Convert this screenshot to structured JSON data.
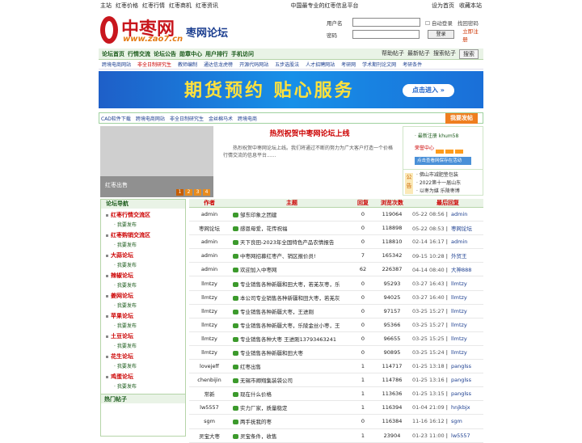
{
  "top": {
    "left_links": [
      "主站",
      "红枣价格",
      "红枣行情",
      "红枣商机",
      "红枣资讯"
    ],
    "center": "中国最专业的红枣信息平台",
    "right_links": [
      "设为首页",
      "收藏本站"
    ]
  },
  "logo": {
    "cn": "中枣网",
    "cn2": "枣网论坛",
    "url": "www.zao7.cn"
  },
  "login": {
    "username_label": "用户名",
    "password_label": "密码",
    "remember_label": "自动登录",
    "forgot_label": "找回密码",
    "login_button": "登录",
    "register_link": "立即注册"
  },
  "nav": {
    "items": [
      "论坛首页",
      "行情交流",
      "论坛公告",
      "勋章中心",
      "用户排行",
      "手机访问"
    ],
    "right": [
      "帮助帖子",
      "最新帖子",
      "搜索帖子"
    ],
    "search_button": "搜索"
  },
  "sub_nav": [
    {
      "label": "跨境电商网站",
      "hot": false
    },
    {
      "label": "非全日制研究生",
      "hot": true
    },
    {
      "label": "教师编制",
      "hot": false
    },
    {
      "label": "通达信龙虎榜",
      "hot": false
    },
    {
      "label": "开源代码网站",
      "hot": false
    },
    {
      "label": "五步选股法",
      "hot": false
    },
    {
      "label": "人才招聘网站",
      "hot": false
    },
    {
      "label": "考研网",
      "hot": false
    },
    {
      "label": "学术期刊论文网",
      "hot": false
    },
    {
      "label": "考研条件",
      "hot": false
    }
  ],
  "banner": {
    "title": "期货预约 贴心服务",
    "button": "点击进入 »"
  },
  "ticker": {
    "items": [
      "CAD软件下载",
      "跨境电商网站",
      "非全日制研究生",
      "金丝棉马术",
      "跨境电商"
    ],
    "post_button": "我要发帖"
  },
  "slider": {
    "caption": "红枣出售",
    "pages": [
      "1",
      "2",
      "3",
      "4"
    ],
    "active": 0
  },
  "news": {
    "headline": "热烈祝贺中枣网论坛上线",
    "body": "热烈祝贺中枣网论坛上线。我们将通过不断的努力为广大客户打造一个价格行情交流的信息平台......"
  },
  "info": {
    "newest": "最新注册 khum58",
    "honor": "荣誉中心",
    "ad": "点击查看网保存在活动",
    "ann_label": "公告",
    "announcements": [
      "佛山市减肥垫包装",
      "2022第十一届山东",
      "以枣为媒 乐陵枣博"
    ]
  },
  "sidebar": {
    "title": "论坛导航",
    "groups": [
      {
        "name": "红枣行情交流区",
        "sub": "我要发布"
      },
      {
        "name": "红枣购销交流区",
        "sub": "我要发布"
      },
      {
        "name": "大蒜论坛",
        "sub": "我要发布"
      },
      {
        "name": "辣椒论坛",
        "sub": "我要发布"
      },
      {
        "name": "姜网论坛",
        "sub": "我要发布"
      },
      {
        "name": "苹果论坛",
        "sub": "我要发布"
      },
      {
        "name": "土豆论坛",
        "sub": "我要发布"
      },
      {
        "name": "花生论坛",
        "sub": "我要发布"
      },
      {
        "name": "鸡蛋论坛",
        "sub": "我要发布"
      }
    ],
    "hot_title": "热门帖子"
  },
  "table": {
    "headers": [
      "作者",
      "主题",
      "回复",
      "浏览次数",
      "最后回复"
    ],
    "rows": [
      {
        "author": "admin",
        "subject": "邹东印象之团建",
        "replies": "0",
        "views": "119064",
        "date": "05-22 08:56",
        "last": "admin"
      },
      {
        "author": "枣网论坛",
        "subject": "感恩母爱，花传祝福",
        "replies": "0",
        "views": "118898",
        "date": "05-22 08:53",
        "last": "枣网论坛"
      },
      {
        "author": "admin",
        "subject": "天下良田-2023年全国特色产品农情报告",
        "replies": "0",
        "views": "118810",
        "date": "02-14 16:17",
        "last": "admin"
      },
      {
        "author": "admin",
        "subject": "中枣网招募红枣产、销区报价员!",
        "replies": "7",
        "views": "165342",
        "date": "09-15 10:28",
        "last": "外贸王"
      },
      {
        "author": "admin",
        "subject": "欢迎加入中枣网",
        "replies": "62",
        "views": "226387",
        "date": "04-14 08:40",
        "last": "大神888"
      },
      {
        "author": "llmtzy",
        "subject": "专业销售各种新疆和田大枣，若羌灰枣，乐",
        "replies": "0",
        "views": "95293",
        "date": "03-27 16:43",
        "last": "llmtzy"
      },
      {
        "author": "llmtzy",
        "subject": "本公司专业销售各种新疆和田大枣，若羌灰",
        "replies": "0",
        "views": "94025",
        "date": "03-27 16:40",
        "last": "llmtzy"
      },
      {
        "author": "llmtzy",
        "subject": "专业销售各种新疆大枣，王进刚",
        "replies": "0",
        "views": "97157",
        "date": "03-25 15:27",
        "last": "llmtzy"
      },
      {
        "author": "llmtzy",
        "subject": "专业销售各种新疆大枣，乐陵金丝小枣，王",
        "replies": "0",
        "views": "95366",
        "date": "03-25 15:27",
        "last": "llmtzy"
      },
      {
        "author": "llmtzy",
        "subject": "专业销售各种大枣 王进刚13793463241",
        "replies": "0",
        "views": "96655",
        "date": "03-25 15:25",
        "last": "llmtzy"
      },
      {
        "author": "llmtzy",
        "subject": "专业销售各种新疆和田大枣",
        "replies": "0",
        "views": "90895",
        "date": "03-25 15:24",
        "last": "llmtzy"
      },
      {
        "author": "lovejeff",
        "subject": "红枣出售",
        "replies": "1",
        "views": "114717",
        "date": "01-25 13:18",
        "last": "panglss"
      },
      {
        "author": "chenbijin",
        "subject": "无锡市卿翔集装袋公司",
        "replies": "1",
        "views": "114786",
        "date": "01-25 13:16",
        "last": "panglss"
      },
      {
        "author": "常新",
        "subject": "现在什么价格",
        "replies": "1",
        "views": "113636",
        "date": "01-25 13:15",
        "last": "panglss"
      },
      {
        "author": "lw5557",
        "subject": "实力厂家，质量稳定",
        "replies": "1",
        "views": "116394",
        "date": "01-04 21:09",
        "last": "hnjkbjx"
      },
      {
        "author": "sgm",
        "subject": "两手抚我的枣",
        "replies": "0",
        "views": "116384",
        "date": "11-16 16:12",
        "last": "sgm"
      },
      {
        "author": "灵宝大枣",
        "subject": "灵宝条件，收售",
        "replies": "1",
        "views": "23904",
        "date": "01-23 11:00",
        "last": "lw5557"
      }
    ]
  },
  "colors": {
    "brand_red": "#c8161d",
    "nav_green": "#1a5a1a",
    "link_blue": "#1a3d8f",
    "orange": "#ef7e1f"
  }
}
